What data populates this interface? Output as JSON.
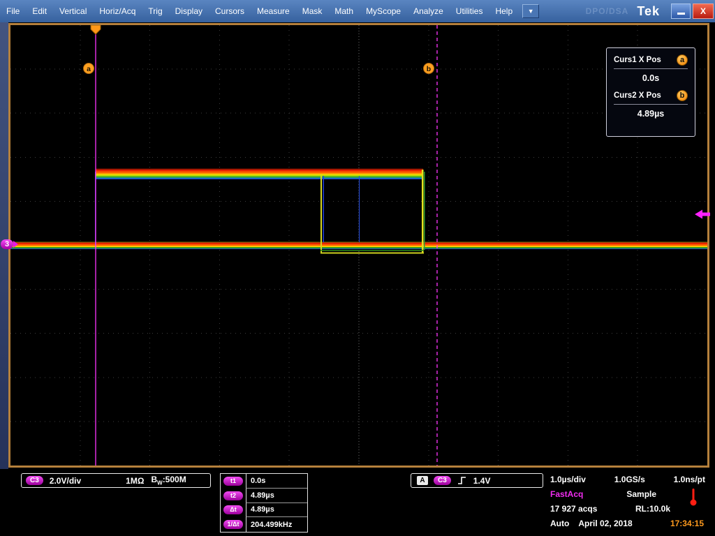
{
  "menu": {
    "items": [
      "File",
      "Edit",
      "Vertical",
      "Horiz/Acq",
      "Trig",
      "Display",
      "Cursors",
      "Measure",
      "Mask",
      "Math",
      "MyScope",
      "Analyze",
      "Utilities",
      "Help"
    ],
    "dropdown_icon": "▼",
    "watermark": "DPO/DSA",
    "logo": "Tek",
    "close_label": "X"
  },
  "cursor_panel": {
    "curs1_label": "Curs1 X Pos",
    "curs1_badge": "a",
    "curs1_value": "0.0s",
    "curs2_label": "Curs2 X Pos",
    "curs2_badge": "b",
    "curs2_value": "4.89µs"
  },
  "graticule": {
    "cursor_a_label": "a",
    "cursor_b_label": "b",
    "channel_badge": "3"
  },
  "status": {
    "channel": {
      "badge": "C3",
      "scale": "2.0V/div",
      "impedance": "1MΩ",
      "bw_main": "B",
      "bw_sub": "W",
      "bw_value": ":500M"
    },
    "cursors": [
      {
        "badge": "t1",
        "value": "0.0s"
      },
      {
        "badge": "t2",
        "value": "4.89µs"
      },
      {
        "badge": "Δt",
        "value": "4.89µs"
      },
      {
        "badge": "1/Δt",
        "value": "204.499kHz"
      }
    ],
    "trigger": {
      "mode_badge": "A",
      "source_badge": "C3",
      "level": "1.4V"
    },
    "acq": {
      "timebase": "1.0µs/div",
      "samplerate": "1.0GS/s",
      "resolution": "1.0ns/pt",
      "fastacq": "FastAcq",
      "sample": "Sample",
      "acqs": "17 927 acqs",
      "record": "RL:10.0k",
      "trig_mode": "Auto",
      "date": "April 02, 2018",
      "time": "17:34:15"
    }
  }
}
